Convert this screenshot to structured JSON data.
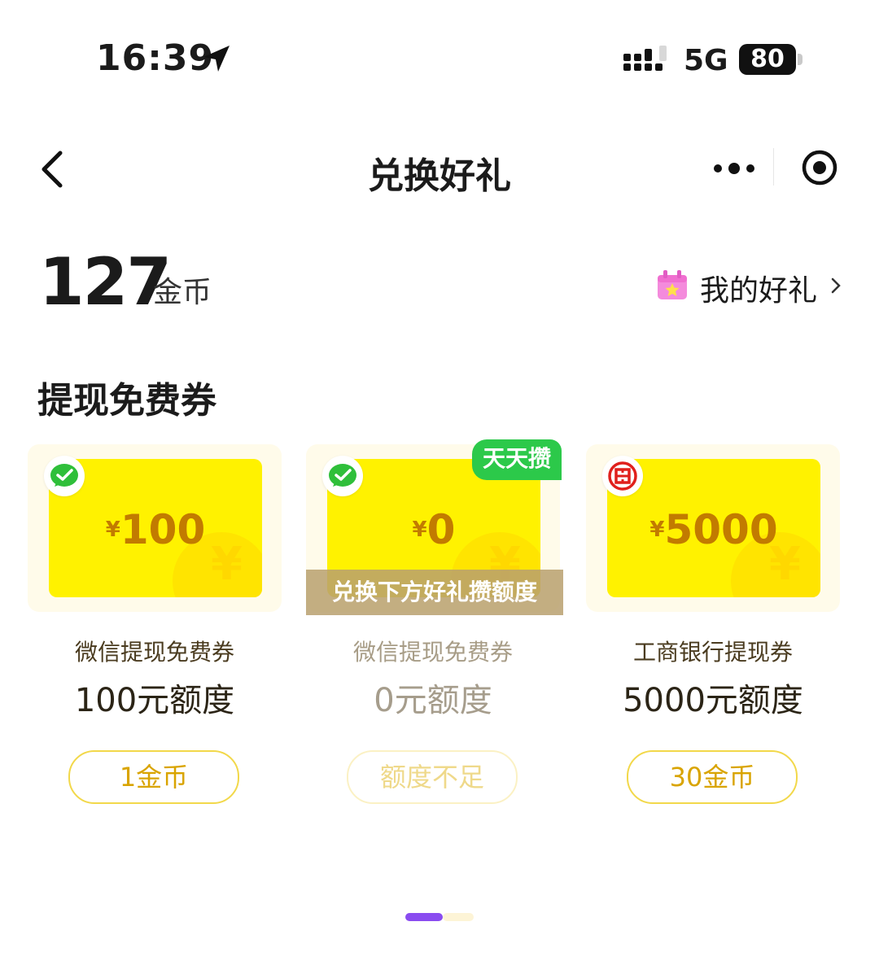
{
  "status_bar": {
    "time": "16:39",
    "network": "5G",
    "battery": "80"
  },
  "nav": {
    "title": "兑换好礼"
  },
  "balance": {
    "amount": "127",
    "unit": "金币",
    "my_gifts": "我的好礼"
  },
  "section_title": "提现免费券",
  "cards": [
    {
      "currency": "¥",
      "amount": "100",
      "name": "微信提现免费券",
      "quota": "100元额度",
      "button": "1金币"
    },
    {
      "currency": "¥",
      "amount": "0",
      "tag": "天天攒",
      "overlay": "兑换下方好礼攒额度",
      "name": "微信提现免费券",
      "quota": "0元额度",
      "button": "额度不足"
    },
    {
      "currency": "¥",
      "amount": "5000",
      "name": "工商银行提现券",
      "quota": "5000元额度",
      "button": "30金币"
    }
  ],
  "colors": {
    "ticket": "#fff200",
    "accent": "#d9a400",
    "tag": "#2cc94a",
    "pager_active": "#8a4cf0"
  },
  "icons": [
    "location-arrow-icon",
    "signal-icon",
    "back-chevron-icon",
    "more-dots-icon",
    "target-icon",
    "gift-box-icon",
    "wechat-icon",
    "icbc-icon"
  ]
}
